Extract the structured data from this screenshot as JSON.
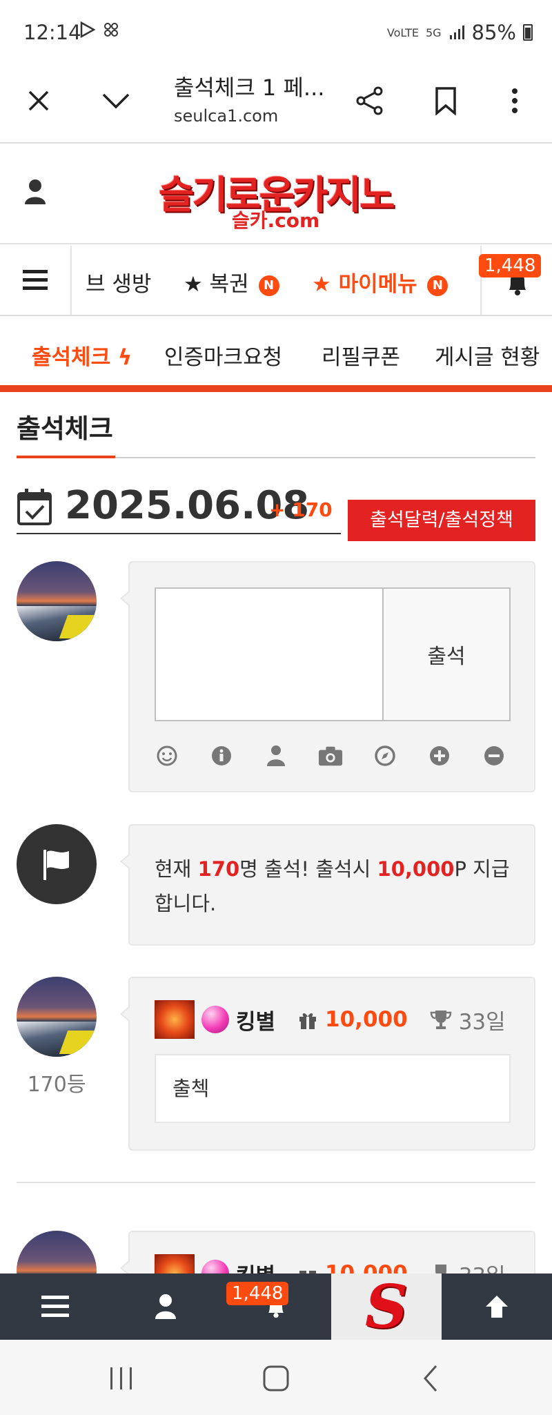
{
  "status_bar": {
    "time": "12:14",
    "network": "5G",
    "battery": "85%"
  },
  "browser": {
    "title": "출석체크 1 페...",
    "url": "seulca1.com"
  },
  "header": {
    "logo_main": "슬기로운카지노",
    "logo_sub": "슬카.com"
  },
  "menu": {
    "items": [
      {
        "label": "브 생방"
      },
      {
        "label": "★ 복권",
        "badge": "N"
      },
      {
        "label": "★ 마이메뉴",
        "badge": "N"
      }
    ],
    "notification_count": "1,448"
  },
  "subtabs": [
    {
      "label": "출석체크 ϟ"
    },
    {
      "label": "인증마크요청"
    },
    {
      "label": "리필쿠폰"
    },
    {
      "label": "게시글 현황"
    }
  ],
  "page": {
    "title": "출석체크",
    "date": "2025.06.08",
    "count": "+ 170",
    "calendar_button": "출석달력/출석정책"
  },
  "composer": {
    "submit_label": "출석",
    "textarea_value": ""
  },
  "notice": {
    "prefix": "현재 ",
    "attendees": "170",
    "middle": "명 출석! 출석시 ",
    "reward": "10,000",
    "suffix": "P 지급합니다."
  },
  "entries": [
    {
      "rank": "170등",
      "nickname": "킹별",
      "points": "10,000",
      "days": "33일",
      "comment": "출첵"
    },
    {
      "nickname": "킹별",
      "points": "10,000",
      "days": "33일"
    }
  ],
  "bottom_nav": {
    "notification_count": "1,448",
    "logo_letter": "S"
  },
  "colors": {
    "accent": "#ff4a10",
    "brand_red": "#e32222",
    "bottom_nav_bg": "#323943"
  }
}
